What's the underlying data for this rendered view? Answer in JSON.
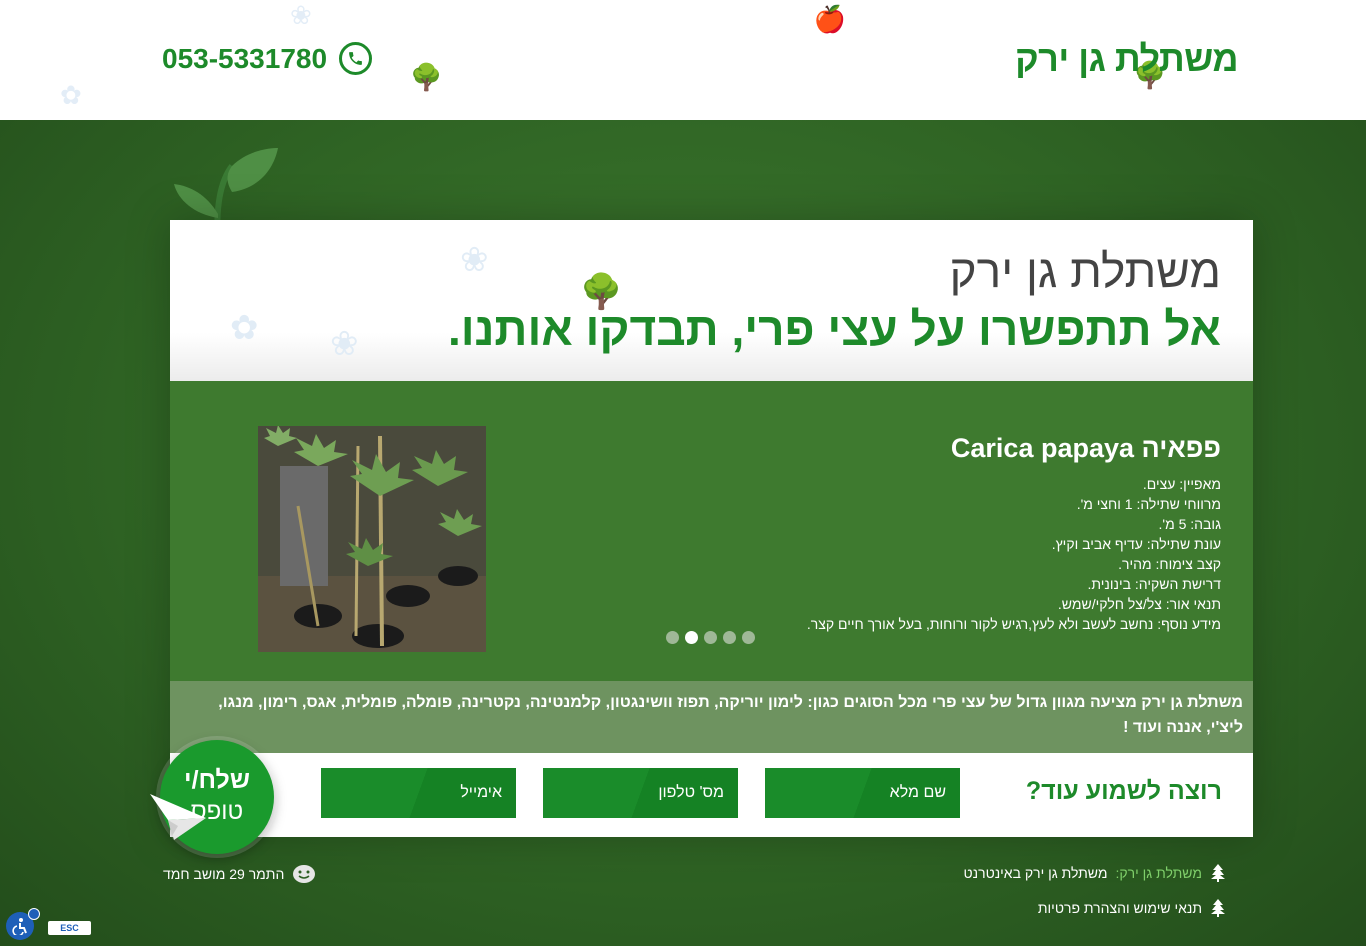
{
  "header": {
    "logo": "משתלת גן ירק",
    "phone": "053-5331780",
    "phone_icon": "phone-icon"
  },
  "hero": {
    "subtitle": "משתלת גן ירק",
    "headline": "אל תתפשרו על עצי פרי, תבדקו אותנו."
  },
  "slider": {
    "title": "פפאיה Carica papaya",
    "specs": [
      "מאפיין: עצים.",
      "מרווחי שתילה: 1 וחצי מ'.",
      "גובה: 5 מ'.",
      "עונת שתילה: עדיף אביב וקיץ.",
      "קצב צימוח: מהיר.",
      "דרישת השקיה: בינונית.",
      "תנאי אור: צל/צל חלקי/שמש.",
      "מידע נוסף: נחשב לעשב ולא לעץ,רגיש לקור ורוחות, בעל אורך חיים קצר."
    ],
    "dots_count": 5,
    "active_dot": 4
  },
  "info": {
    "text": "משתלת גן ירק מציעה מגוון גדול של עצי פרי מכל הסוגים כגון: לימון יוריקה, תפוז וושינגטון, קלמנטינה, נקטרינה, פומלה, פומלית, אגס, רימון, מנגו, ליצ'י, אננה ועוד !"
  },
  "form": {
    "title": "רוצה לשמוע עוד?",
    "name_placeholder": "שם מלא",
    "phone_placeholder": "מס' טלפון",
    "email_placeholder": "אימייל",
    "send_main": "שלח/י",
    "send_sub": "טופס"
  },
  "footer": {
    "link1_green": "משתלת גן ירק:",
    "link1_rest": "משתלת גן ירק באינטרנט",
    "link2": "תנאי שימוש והצהרת פרטיות",
    "address": "התמר 29 מושב חמד"
  },
  "accessibility": {
    "esc_label": "ESC"
  },
  "colors": {
    "brand_green": "#1d8a2a",
    "background_green": "#2f6424",
    "slider_green": "#3e7a2f"
  }
}
